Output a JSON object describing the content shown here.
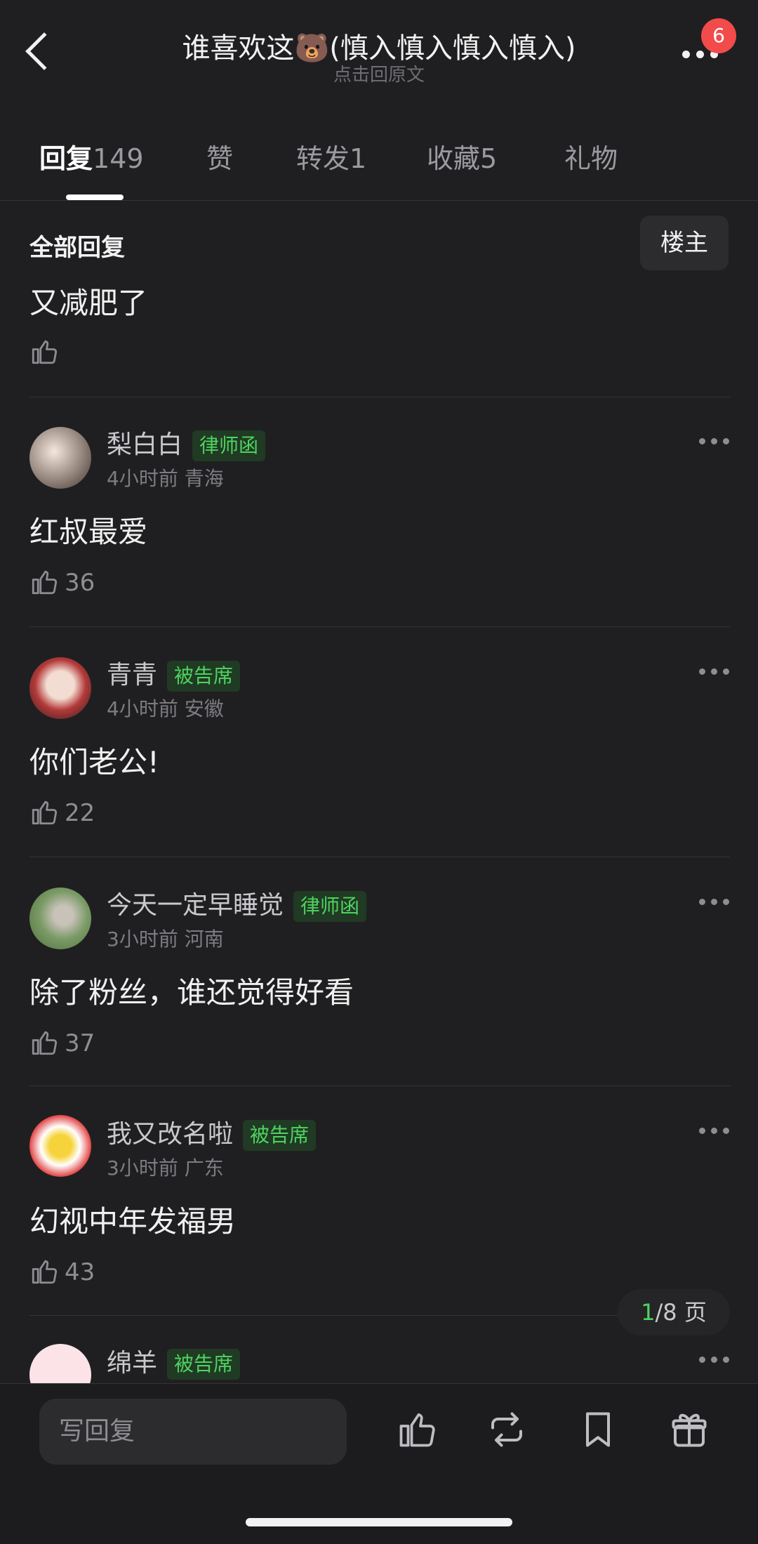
{
  "header": {
    "title": "谁喜欢这🐻(慎入慎入慎入慎入)",
    "subtitle": "点击回原文",
    "notification_count": "6"
  },
  "tabs": [
    {
      "label": "回复",
      "count": "149"
    },
    {
      "label": "赞",
      "count": ""
    },
    {
      "label": "转发",
      "count": "1"
    },
    {
      "label": "收藏",
      "count": "5"
    },
    {
      "label": "礼物",
      "count": ""
    }
  ],
  "section": {
    "title": "全部回复",
    "filter_label": "楼主"
  },
  "first_reply": {
    "text": "又减肥了",
    "likes": ""
  },
  "comments": [
    {
      "name": "梨白白",
      "tag": "律师函",
      "time": "4小时前",
      "location": "青海",
      "text": "红叔最爱",
      "likes": "36"
    },
    {
      "name": "青青",
      "tag": "被告席",
      "time": "4小时前",
      "location": "安徽",
      "text": "你们老公!",
      "likes": "22"
    },
    {
      "name": "今天一定早睡觉",
      "tag": "律师函",
      "time": "3小时前",
      "location": "河南",
      "text": "除了粉丝，谁还觉得好看",
      "likes": "37"
    },
    {
      "name": "我又改名啦",
      "tag": "被告席",
      "time": "3小时前",
      "location": "广东",
      "text": "幻视中年发福男",
      "likes": "43"
    },
    {
      "name": "绵羊",
      "tag": "被告席",
      "time": "",
      "location": "",
      "text": "",
      "likes": ""
    }
  ],
  "pager": {
    "current": "1",
    "total_text": "/8 页"
  },
  "bottom": {
    "reply_placeholder": "写回复"
  },
  "colors": {
    "accent_green": "#4ed35f",
    "badge_red": "#f24b4b",
    "background": "#1f1f21"
  },
  "icons": [
    "back-arrow-icon",
    "more-icon",
    "thumb-up-icon",
    "repost-icon",
    "bookmark-icon",
    "gift-icon"
  ]
}
